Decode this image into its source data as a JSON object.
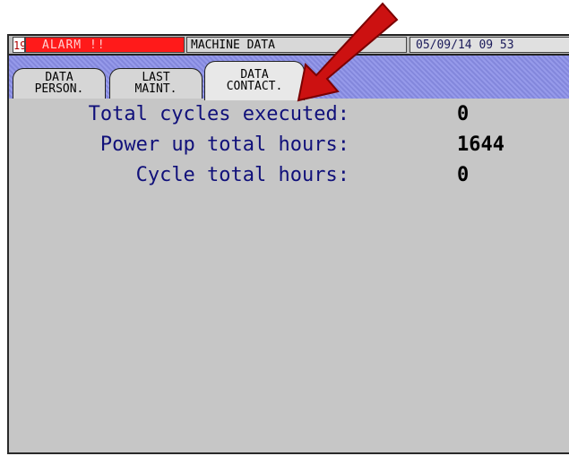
{
  "status_bar": {
    "code": "19",
    "alarm": "ALARM !!",
    "title": "MACHINE DATA",
    "datetime": "05/09/14  09 53"
  },
  "tabs": [
    {
      "line1": "DATA",
      "line2": "PERSON."
    },
    {
      "line1": "LAST",
      "line2": "MAINT."
    },
    {
      "line1": "DATA",
      "line2": "CONTACT."
    }
  ],
  "rows": [
    {
      "label": "Total cycles executed:",
      "value": "0"
    },
    {
      "label": "Power up total hours:",
      "value": "1644"
    },
    {
      "label": "Cycle total hours:",
      "value": "0"
    }
  ],
  "colors": {
    "alarm_bg": "#ff1a1a",
    "tab_strip": "#8a8ee8",
    "label_text": "#10107a",
    "arrow": "#cc1111"
  }
}
